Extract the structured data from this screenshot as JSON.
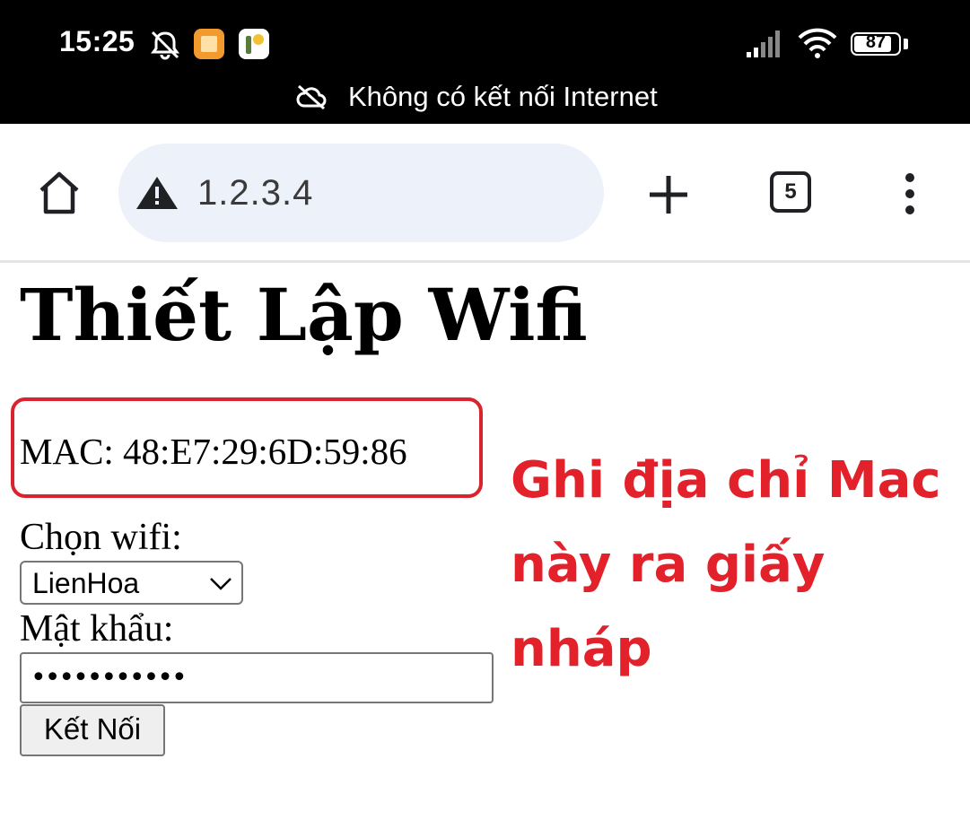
{
  "status_bar": {
    "time": "15:25",
    "battery": "87",
    "battery_level": 0.87,
    "notice": "Không có kết nối Internet",
    "icons": [
      "dnd-off-icon",
      "notes-app-icon",
      "game-app-icon",
      "signal-icon",
      "wifi-icon",
      "battery-icon",
      "cloud-off-icon"
    ]
  },
  "browser": {
    "url": "1.2.3.4",
    "tab_count": "5",
    "icons": [
      "home-icon",
      "warning-icon",
      "new-tab-icon",
      "tab-switcher-icon",
      "menu-icon"
    ]
  },
  "page": {
    "title": "Thiết Lập Wifi",
    "mac_text": "MAC: 48:E7:29:6D:59:86",
    "wifi_label": "Chọn wifi:",
    "wifi_selected": "LienHoa",
    "password_label": "Mật khẩu:",
    "password_masked": "•••••••••••",
    "connect_button": "Kết Nối"
  },
  "annotation": {
    "text": "Ghi địa chỉ Mac này ra giấy nháp",
    "color": "#e3212b"
  }
}
